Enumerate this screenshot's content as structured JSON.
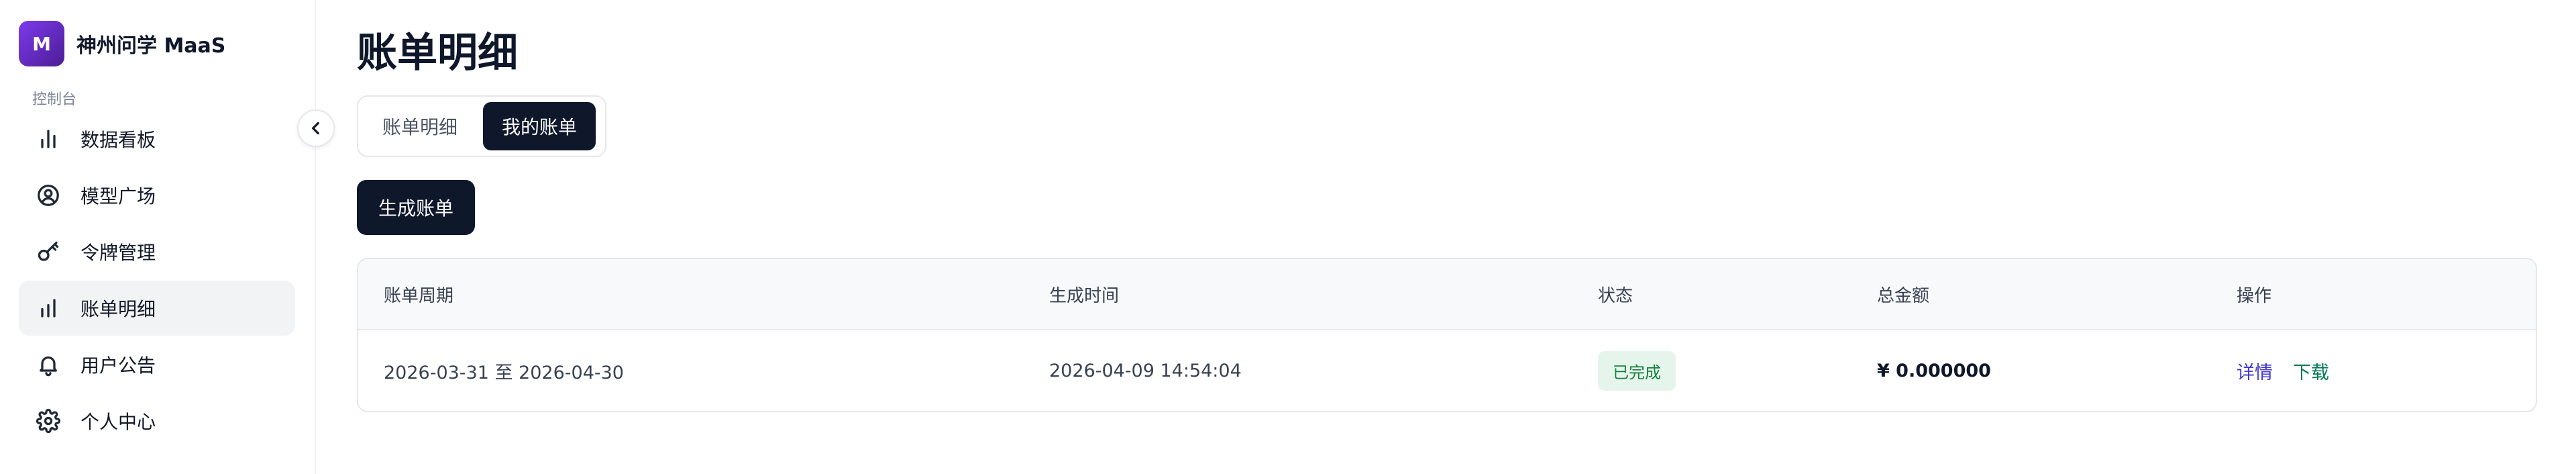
{
  "brand": {
    "logo_letter": "M",
    "name": "神州问学 MaaS"
  },
  "sidebar": {
    "section_label": "控制台",
    "items": [
      {
        "label": "数据看板",
        "icon": "bar-chart-icon",
        "active": false
      },
      {
        "label": "模型广场",
        "icon": "user-circle-icon",
        "active": false
      },
      {
        "label": "令牌管理",
        "icon": "key-icon",
        "active": false
      },
      {
        "label": "账单明细",
        "icon": "bar-chart-icon",
        "active": true
      },
      {
        "label": "用户公告",
        "icon": "bell-icon",
        "active": false
      },
      {
        "label": "个人中心",
        "icon": "gear-icon",
        "active": false
      }
    ]
  },
  "page": {
    "title": "账单明细"
  },
  "tabs": [
    {
      "label": "账单明细",
      "active": false
    },
    {
      "label": "我的账单",
      "active": true
    }
  ],
  "actions": {
    "generate_label": "生成账单"
  },
  "table": {
    "headers": [
      "账单周期",
      "生成时间",
      "状态",
      "总金额",
      "操作"
    ],
    "rows": [
      {
        "period": "2026-03-31 至 2026-04-30",
        "created": "2026-04-09 14:54:04",
        "status": "已完成",
        "amount": "¥ 0.000000",
        "detail_label": "详情",
        "download_label": "下载"
      }
    ]
  },
  "colors": {
    "primary": "#0f172a",
    "brand_purple": "#6d28d9",
    "success_bg": "#e6f5ec",
    "success_text": "#15803d",
    "link_detail": "#4338ca",
    "link_download": "#047857"
  }
}
